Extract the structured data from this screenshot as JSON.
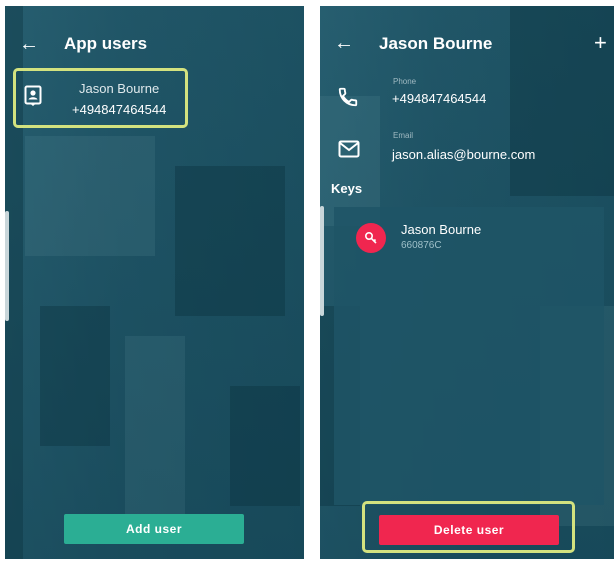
{
  "screen1": {
    "header": {
      "back_icon": "arrow-left-icon",
      "title": "App users"
    },
    "user": {
      "name": "Jason Bourne",
      "phone": "+494847464544",
      "icon": "contact-card-icon"
    },
    "add_button": "Add user"
  },
  "screen2": {
    "header": {
      "back_icon": "arrow-left-icon",
      "title": "Jason Bourne",
      "add_icon": "plus-icon"
    },
    "phone": {
      "label": "Phone",
      "value": "+494847464544",
      "icon": "phone-icon"
    },
    "email": {
      "label": "Email",
      "value": "jason.alias@bourne.com",
      "icon": "mail-icon"
    },
    "keys_heading": "Keys",
    "keys": [
      {
        "name": "Jason Bourne",
        "id": "660876C",
        "icon": "key-icon"
      }
    ],
    "delete_button": "Delete user"
  },
  "colors": {
    "highlight": "#d3e27f",
    "add_button": "#2bae94",
    "delete_button": "#f0264f",
    "background": "#24596b"
  }
}
